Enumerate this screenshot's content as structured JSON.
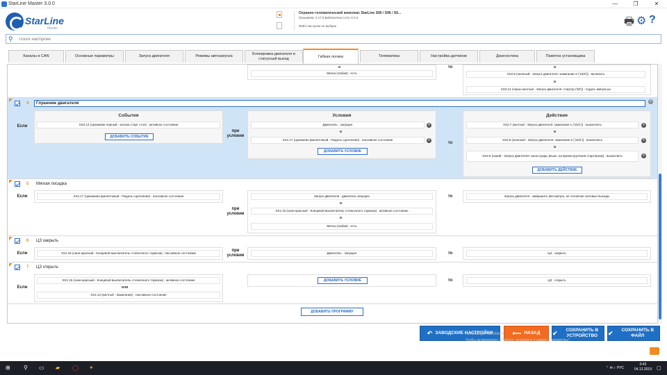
{
  "window": {
    "title": "StarLine Master 3.0.0",
    "min": "—",
    "max": "❐",
    "close": "✕"
  },
  "logo": {
    "name": "StarLine",
    "sub": "Master"
  },
  "device": {
    "line1": "Охранно-телематический комплекс StarLine S66 / S96 / S6...",
    "line2": "Прошивка: 2.17.0   Библиотека CAN: 8.0.0",
    "line3": "Файл настроек не выбран"
  },
  "icons": {
    "print": "print-icon",
    "settings": "gear-icon",
    "help": "help-icon",
    "search": "search-icon"
  },
  "search": {
    "placeholder": "Поиск настроек"
  },
  "tabs": [
    {
      "label": "Каналы и CAN"
    },
    {
      "label": "Основные параметры"
    },
    {
      "label": "Запуск двигателя"
    },
    {
      "label": "Режимы автозапуска"
    },
    {
      "label": "Блокировка двигателя и статусный выход"
    },
    {
      "label": "Гибкая логика",
      "active": true
    },
    {
      "label": "Телематика"
    },
    {
      "label": "Настройка датчиков"
    },
    {
      "label": "Диагностика"
    },
    {
      "label": "Памятка установщика"
    }
  ],
  "words": {
    "if": "Если",
    "when": "при условии",
    "then": "то",
    "and": "и",
    "or": "или",
    "events": "События",
    "conditions": "Условия",
    "actions": "Действия",
    "add_event": "ДОБАВИТЬ СОБЫТИЕ",
    "add_condition": "ДОБАВИТЬ УСЛОВИЕ",
    "add_action": "ДОБАВИТЬ ДЕЙСТВИЕ",
    "add_program": "ДОБАВИТЬ ПРОГРАММУ"
  },
  "top": {
    "cond": "Метка (любая) : есть",
    "act1": "XS2:8 (зеленый - Запуск двигателя: зажигание-2 ('15/2')) : включить",
    "act2": "XS2:14 (черно-желтый - Запуск двигателя: стартер ('50')) : подать импульсы"
  },
  "rules": [
    {
      "num": "4",
      "name": "Глушение двигателя",
      "event": "XS2:13 (оранжево-черный - кнопка старт стоп) : активное состояние",
      "cond1": "Двигатель : запущен",
      "cond2": "XS1:17 (оранжево-фиолетовый - Педаль сцепления) : пассивное состояние",
      "act1": "XS2:7 (желтый - Запуск двигателя: зажигание-1 ('15/1')) : выключить",
      "act2": "XS2:8 (зеленый - Запуск двигателя: зажигание-2 ('15/2')) : выключить",
      "act3": "XS2:6 (синий - Запуск двигателя: аксессуары (выкл. на время кручения стартером)) : выключить"
    },
    {
      "num": "5",
      "name": "Мягкая посадка",
      "event": "XS1:17 (оранжево-фиолетовый - Педаль сцепления) : пассивное состояние",
      "cond1": "Запуск двигателя : двигатель запущен",
      "cond2": "XS1:15 (сине-красный - Концевой выключатель стояночного тормоза) : активное состояние",
      "cond3": "Метка (любая) : есть",
      "act1": "Запуск двигателя : завершить автозапуск, не отключая силовые выходы"
    },
    {
      "num": "6",
      "name": "ЦЗ закрыть",
      "event": "XS1:15 (сине-красный - Концевой выключатель стояночного тормоза) : пассивное состояние",
      "cond1": "Двигатель : запущен",
      "act1": "ЦЗ : закрыть"
    },
    {
      "num": "7",
      "name": "ЦЗ открыть",
      "event1": "XS1:15 (сине-красный - Концевой выключатель стояночного тормоза) : активное состояние",
      "event2": "XS1:14 (желтый - Зажигание) : пассивное состояние",
      "act1": "ЦЗ : открыть"
    }
  ],
  "footer": {
    "factory": "ЗАВОДСКИЕ НАСТРОЙКИ",
    "back": "НАЗАД",
    "save_device": "СОХРАНИТЬ В УСТРОЙСТВО",
    "save_file": "СОХРАНИТЬ В ФАЙЛ"
  },
  "watermark": {
    "l1": "Активация Windows",
    "l2": "Чтобы активировать Windows, перейдите в раздел \"Параметры\"."
  },
  "taskbar": {
    "time": "0:43",
    "date": "04.12.2019",
    "lang": "РУС"
  }
}
